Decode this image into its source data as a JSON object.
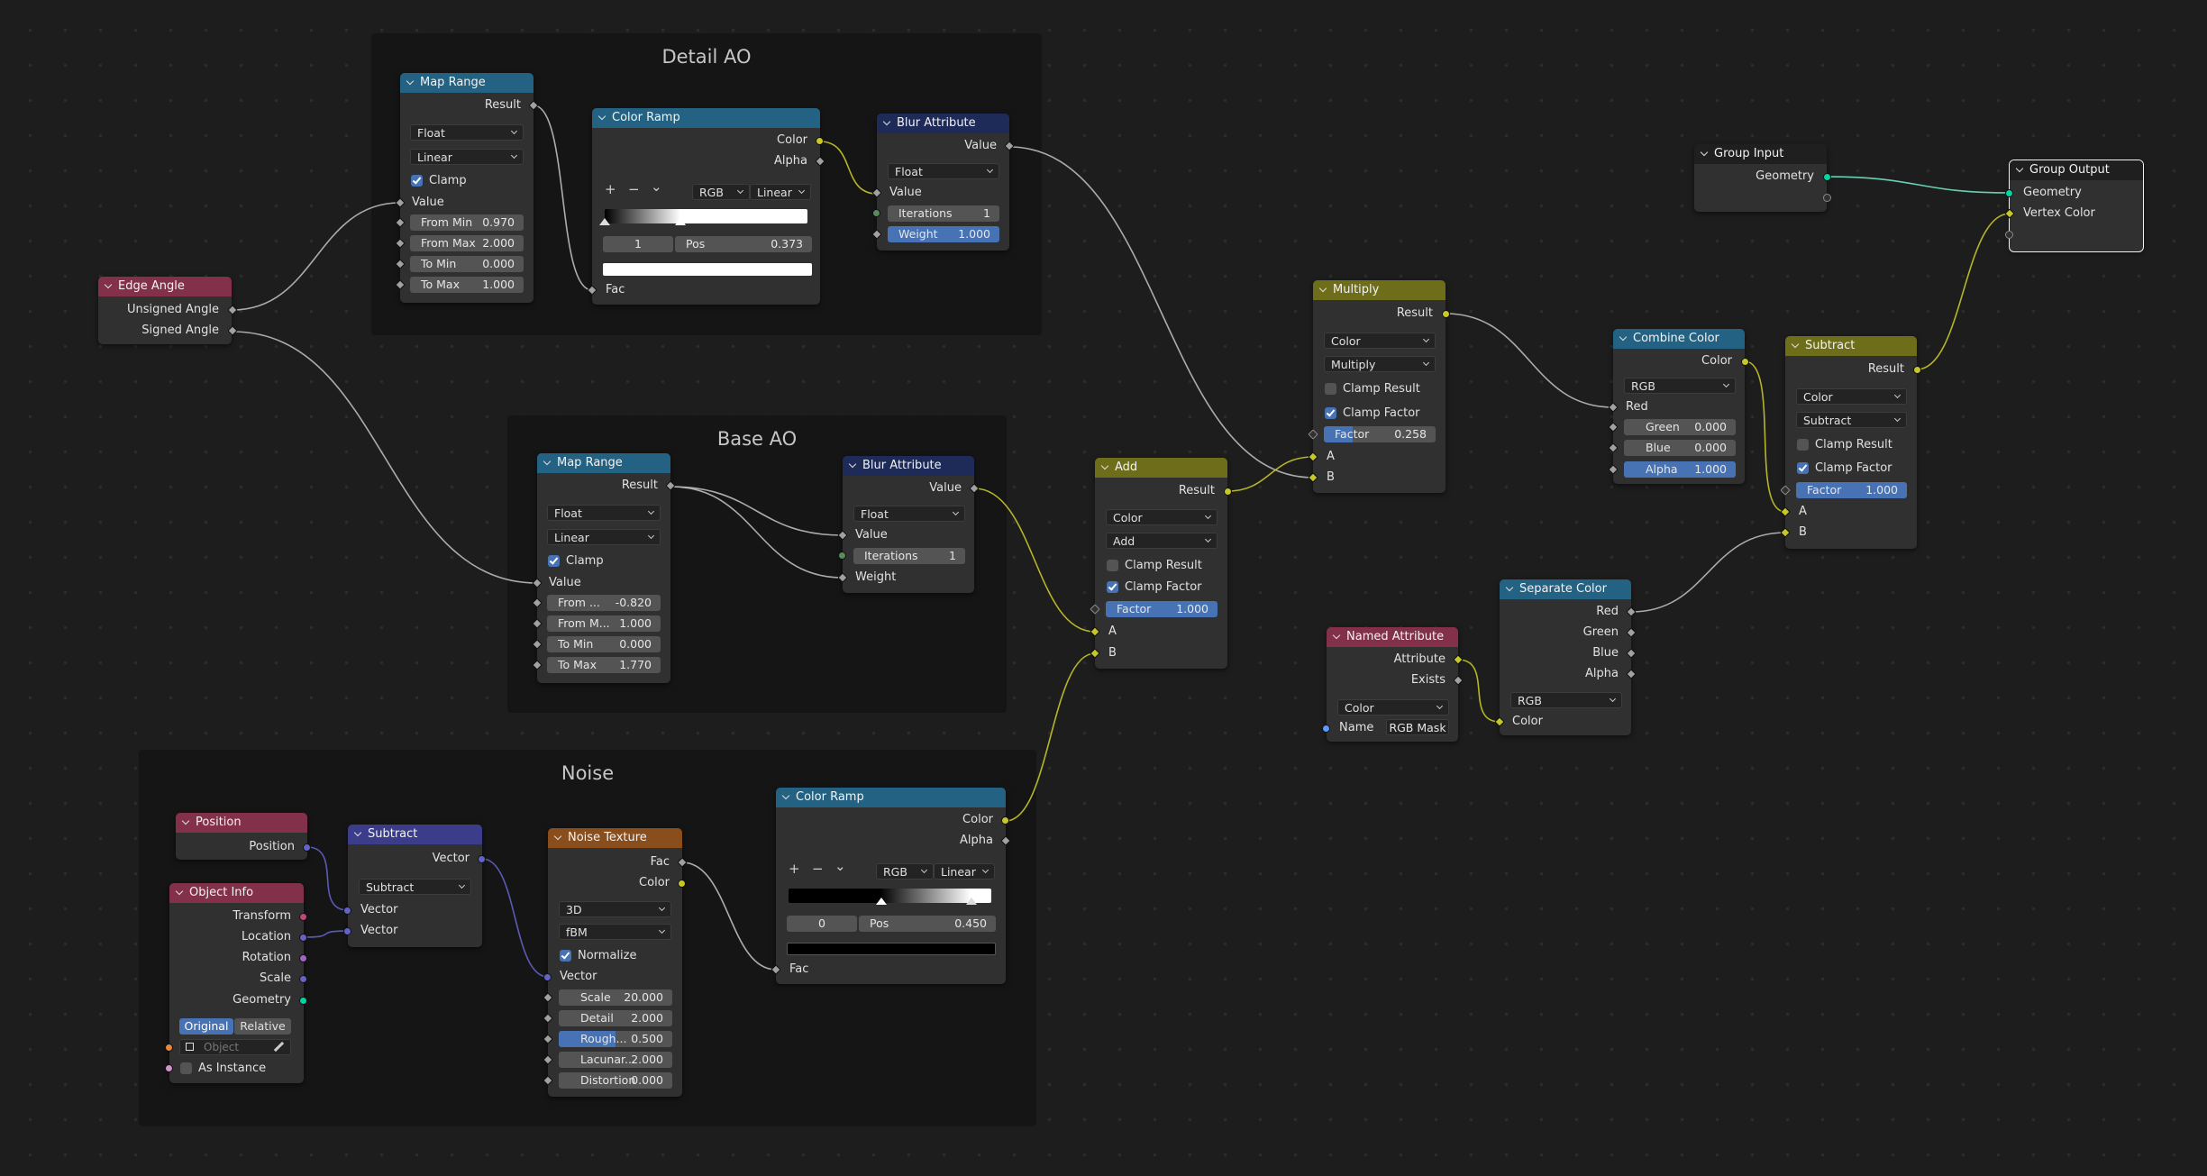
{
  "frames": {
    "detail_ao": "Detail AO",
    "base_ao": "Base AO",
    "noise": "Noise"
  },
  "edge_angle": {
    "title": "Edge Angle",
    "out_unsigned": "Unsigned Angle",
    "out_signed": "Signed Angle"
  },
  "map_range_1": {
    "title": "Map Range",
    "out_result": "Result",
    "type": "Float",
    "interp": "Linear",
    "clamp": "Clamp",
    "in_value": "Value",
    "from_min_label": "From Min",
    "from_min": "0.970",
    "from_max_label": "From Max",
    "from_max": "2.000",
    "to_min_label": "To Min",
    "to_min": "0.000",
    "to_max_label": "To Max",
    "to_max": "1.000"
  },
  "color_ramp_1": {
    "title": "Color Ramp",
    "out_color": "Color",
    "out_alpha": "Alpha",
    "add": "+",
    "remove": "−",
    "menu": "⌄",
    "mode": "RGB",
    "interp": "Linear",
    "index": "1",
    "pos_label": "Pos",
    "pos": "0.373",
    "in_fac": "Fac",
    "stop_positions": [
      0.0,
      0.373
    ],
    "selected_color": "#ffffff"
  },
  "blur_1": {
    "title": "Blur Attribute",
    "out_value": "Value",
    "type": "Float",
    "in_value": "Value",
    "iter_label": "Iterations",
    "iterations": "1",
    "weight_label": "Weight",
    "weight": "1.000"
  },
  "map_range_2": {
    "title": "Map Range",
    "out_result": "Result",
    "type": "Float",
    "interp": "Linear",
    "clamp": "Clamp",
    "in_value": "Value",
    "from_min_label": "From ...",
    "from_min": "-0.820",
    "from_max_label": "From M...",
    "from_max": "1.000",
    "to_min_label": "To Min",
    "to_min": "0.000",
    "to_max_label": "To Max",
    "to_max": "1.770"
  },
  "blur_2": {
    "title": "Blur Attribute",
    "out_value": "Value",
    "type": "Float",
    "in_value": "Value",
    "iter_label": "Iterations",
    "iterations": "1",
    "in_weight": "Weight"
  },
  "position": {
    "title": "Position",
    "out_position": "Position"
  },
  "object_info": {
    "title": "Object Info",
    "out_transform": "Transform",
    "out_location": "Location",
    "out_rotation": "Rotation",
    "out_scale": "Scale",
    "out_geometry": "Geometry",
    "seg_original": "Original",
    "seg_relative": "Relative",
    "object_placeholder": "Object",
    "as_instance": "As Instance"
  },
  "vec_subtract": {
    "title": "Subtract",
    "out_vector": "Vector",
    "op": "Subtract",
    "in_vector_a": "Vector",
    "in_vector_b": "Vector"
  },
  "noise_texture": {
    "title": "Noise Texture",
    "out_fac": "Fac",
    "out_color": "Color",
    "dims": "3D",
    "type": "fBM",
    "normalize": "Normalize",
    "in_vector": "Vector",
    "scale_label": "Scale",
    "scale": "20.000",
    "detail_label": "Detail",
    "detail": "2.000",
    "rough_label": "Rough...",
    "roughness": "0.500",
    "lac_label": "Lacunar...",
    "lacunarity": "2.000",
    "dist_label": "Distortion",
    "distortion": "0.000"
  },
  "color_ramp_2": {
    "title": "Color Ramp",
    "out_color": "Color",
    "out_alpha": "Alpha",
    "add": "+",
    "remove": "−",
    "menu": "⌄",
    "mode": "RGB",
    "interp": "Linear",
    "index": "0",
    "pos_label": "Pos",
    "pos": "0.450",
    "in_fac": "Fac",
    "stop_positions": [
      0.45,
      0.9
    ],
    "selected_color": "#000000"
  },
  "add": {
    "title": "Add",
    "out_result": "Result",
    "type": "Color",
    "op": "Add",
    "clamp_result": "Clamp Result",
    "clamp_factor": "Clamp Factor",
    "factor_label": "Factor",
    "factor": "1.000",
    "in_a": "A",
    "in_b": "B"
  },
  "multiply": {
    "title": "Multiply",
    "out_result": "Result",
    "type": "Color",
    "op": "Multiply",
    "clamp_result": "Clamp Result",
    "clamp_factor": "Clamp Factor",
    "factor_label": "Factor",
    "factor": "0.258",
    "factor_fraction": 0.258,
    "in_a": "A",
    "in_b": "B"
  },
  "combine_color": {
    "title": "Combine Color",
    "out_color": "Color",
    "mode": "RGB",
    "in_red": "Red",
    "green_label": "Green",
    "green": "0.000",
    "blue_label": "Blue",
    "blue": "0.000",
    "alpha_label": "Alpha",
    "alpha": "1.000"
  },
  "subtract": {
    "title": "Subtract",
    "out_result": "Result",
    "type": "Color",
    "op": "Subtract",
    "clamp_result": "Clamp Result",
    "clamp_factor": "Clamp Factor",
    "factor_label": "Factor",
    "factor": "1.000",
    "in_a": "A",
    "in_b": "B"
  },
  "named_attribute": {
    "title": "Named Attribute",
    "out_attribute": "Attribute",
    "out_exists": "Exists",
    "type": "Color",
    "name_label": "Name",
    "name_value": "RGB Mask"
  },
  "separate_color": {
    "title": "Separate Color",
    "out_red": "Red",
    "out_green": "Green",
    "out_blue": "Blue",
    "out_alpha": "Alpha",
    "mode": "RGB",
    "in_color": "Color"
  },
  "group_input": {
    "title": "Group Input",
    "out_geometry": "Geometry"
  },
  "group_output": {
    "title": "Group Output",
    "in_geometry": "Geometry",
    "in_vertex_color": "Vertex Color"
  },
  "colors": {
    "wire": "#bdbdbd",
    "wire_color": "#c7c729",
    "wire_vector": "#6363c7",
    "wire_geometry": "#72e3c7"
  }
}
